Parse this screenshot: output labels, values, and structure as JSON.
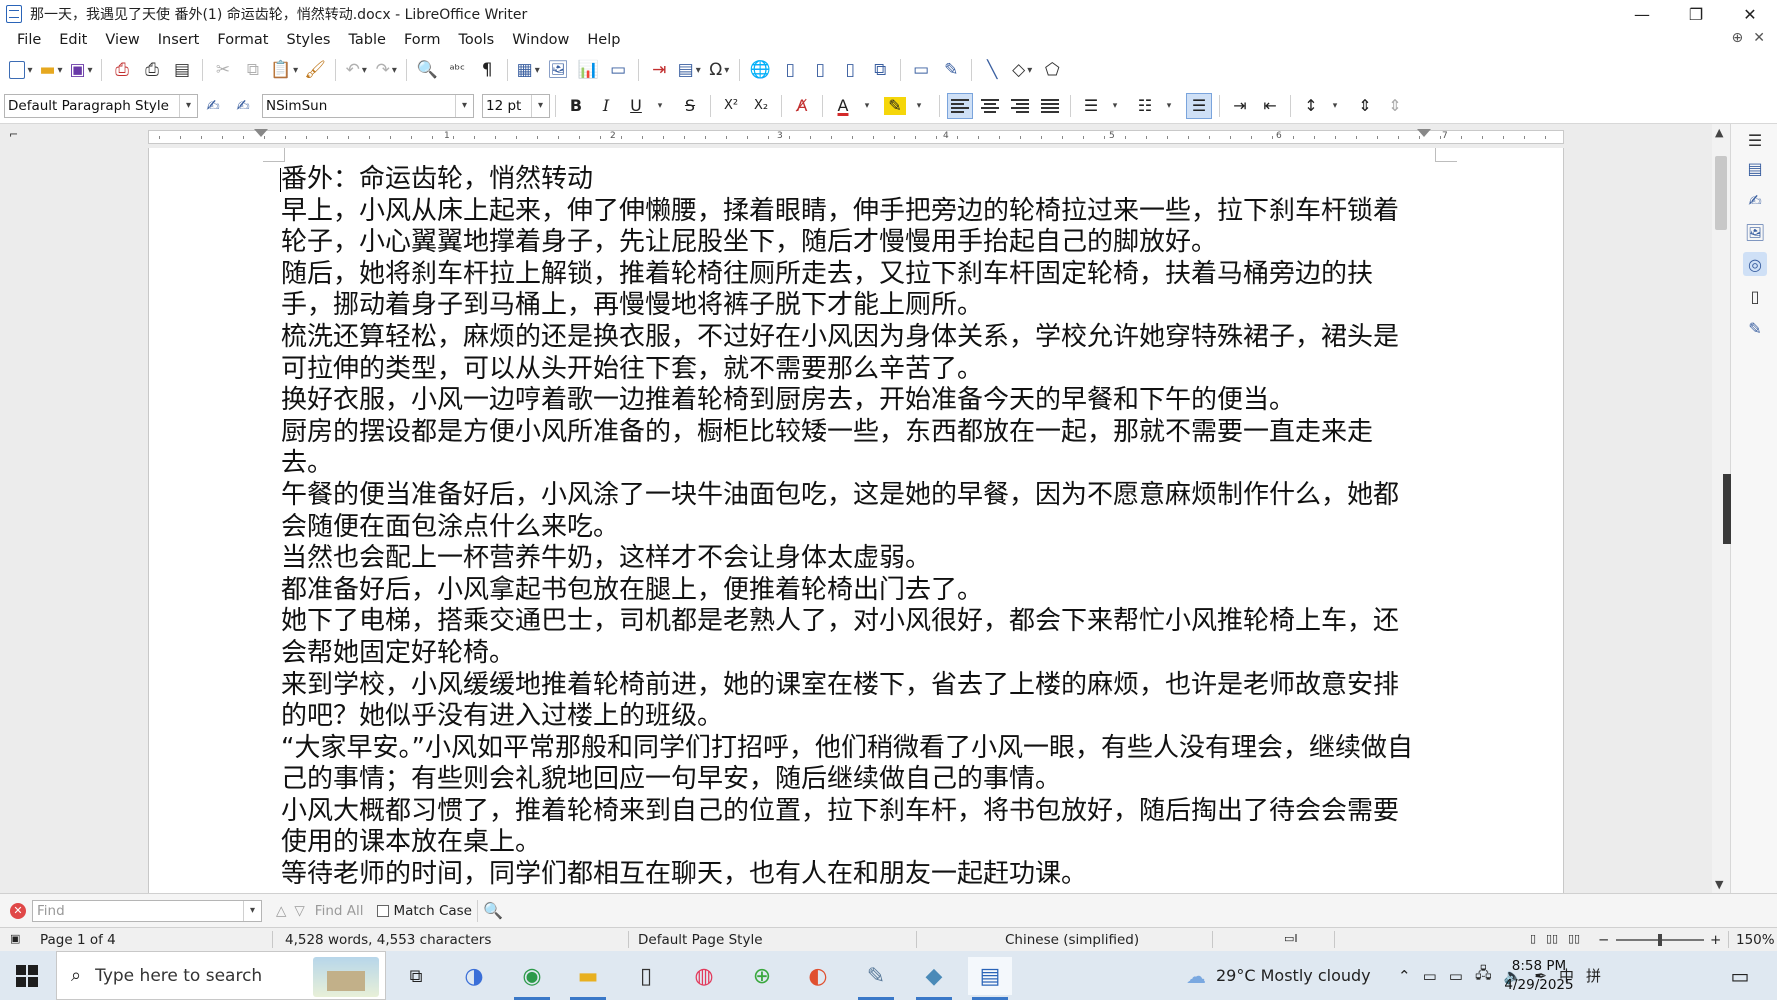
{
  "window": {
    "title": "那一天，我遇见了天使 番外(1) 命运齿轮，悄然转动.docx - LibreOffice Writer",
    "buttons": {
      "minimize": "—",
      "restore": "❐",
      "close": "✕"
    }
  },
  "menubar": {
    "items": [
      "File",
      "Edit",
      "View",
      "Insert",
      "Format",
      "Styles",
      "Table",
      "Form",
      "Tools",
      "Window",
      "Help"
    ],
    "right_icons": [
      "⊕",
      "✕"
    ]
  },
  "toolbar_standard": {
    "icons": [
      "new-icon",
      "open-icon",
      "save-icon",
      "export-pdf-icon",
      "print-icon",
      "print-preview-icon",
      "cut-icon",
      "copy-icon",
      "paste-icon",
      "clone-formatting-icon",
      "undo-icon",
      "redo-icon",
      "find-replace-icon",
      "spelling-icon",
      "formatting-marks-icon",
      "insert-table-icon",
      "insert-image-icon",
      "insert-chart-icon",
      "insert-textbox-icon",
      "page-break-icon",
      "insert-field-icon",
      "special-character-icon",
      "hyperlink-icon",
      "footnote-icon",
      "endnote-icon",
      "bookmark-icon",
      "cross-reference-icon",
      "comment-icon",
      "track-changes-icon",
      "line-icon",
      "shapes-icon",
      "draw-functions-icon"
    ]
  },
  "toolbar_formatting": {
    "paragraph_style": "Default Paragraph Style",
    "font_name": "NSimSun",
    "font_size": "12 pt",
    "bold": "B",
    "italic": "I",
    "underline": "U",
    "strikethrough": "S",
    "superscript": "X²",
    "subscript": "X₂",
    "font_color_accent": "#d42a2a",
    "highlight_accent": "#f5d60a"
  },
  "ruler": {
    "numbers": [
      "1",
      "2",
      "3",
      "4",
      "5",
      "6",
      "7"
    ]
  },
  "document": {
    "paragraphs": [
      "番外：命运齿轮，悄然转动",
      "早上，小风从床上起来，伸了伸懒腰，揉着眼睛，伸手把旁边的轮椅拉过来一些，拉下刹车杆锁着轮子，小心翼翼地撑着身子，先让屁股坐下，随后才慢慢用手抬起自己的脚放好。",
      "随后，她将刹车杆拉上解锁，推着轮椅往厕所走去，又拉下刹车杆固定轮椅，扶着马桶旁边的扶手，挪动着身子到马桶上，再慢慢地将裤子脱下才能上厕所。",
      "梳洗还算轻松，麻烦的还是换衣服，不过好在小风因为身体关系，学校允许她穿特殊裙子，裙头是可拉伸的类型，可以从头开始往下套，就不需要那么辛苦了。",
      "换好衣服，小风一边哼着歌一边推着轮椅到厨房去，开始准备今天的早餐和下午的便当。",
      "厨房的摆设都是方便小风所准备的，橱柜比较矮一些，东西都放在一起，那就不需要一直走来走去。",
      "午餐的便当准备好后，小风涂了一块牛油面包吃，这是她的早餐，因为不愿意麻烦制作什么，她都会随便在面包涂点什么来吃。",
      "当然也会配上一杯营养牛奶，这样才不会让身体太虚弱。",
      "都准备好后，小风拿起书包放在腿上，便推着轮椅出门去了。",
      "她下了电梯，搭乘交通巴士，司机都是老熟人了，对小风很好，都会下来帮忙小风推轮椅上车，还会帮她固定好轮椅。",
      "来到学校，小风缓缓地推着轮椅前进，她的课室在楼下，省去了上楼的麻烦，也许是老师故意安排的吧？她似乎没有进入过楼上的班级。",
      "“大家早安。”小风如平常那般和同学们打招呼，他们稍微看了小风一眼，有些人没有理会，继续做自己的事情；有些则会礼貌地回应一句早安，随后继续做自己的事情。",
      "小风大概都习惯了，推着轮椅来到自己的位置，拉下刹车杆，将书包放好，随后掏出了待会会需要使用的课本放在桌上。",
      "等待老师的时间，同学们都相互在聊天，也有人在和朋友一起赶功课。"
    ]
  },
  "findbar": {
    "placeholder": "Find",
    "find_all": "Find All",
    "match_case": "Match Case"
  },
  "statusbar": {
    "page": "Page 1 of 4",
    "words": "4,528 words, 4,553 characters",
    "page_style": "Default Page Style",
    "language": "Chinese (simplified)",
    "zoom": "150%"
  },
  "taskbar": {
    "search_placeholder": "Type here to search",
    "weather": "29°C  Mostly cloudy",
    "ime_1": "中",
    "ime_2": "拼",
    "time": "8:58 PM",
    "date": "4/29/2025"
  }
}
